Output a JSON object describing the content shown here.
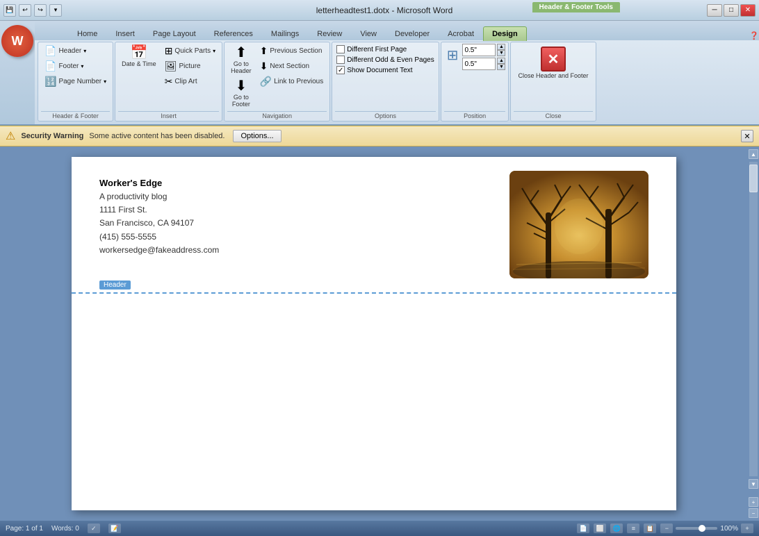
{
  "titlebar": {
    "title": "letterheadtest1.dotx - Microsoft Word",
    "htf_label": "Header & Footer Tools",
    "min_btn": "─",
    "max_btn": "□",
    "close_btn": "✕"
  },
  "quickaccess": {
    "btns": [
      "💾",
      "↩",
      "↪",
      "⊞",
      "▾"
    ]
  },
  "tabs": [
    {
      "label": "Home",
      "key": "H"
    },
    {
      "label": "Insert",
      "key": "N"
    },
    {
      "label": "Page Layout",
      "key": "P"
    },
    {
      "label": "References",
      "key": "S"
    },
    {
      "label": "Mailings",
      "key": "M"
    },
    {
      "label": "Review",
      "key": "R"
    },
    {
      "label": "View",
      "key": "W"
    },
    {
      "label": "Developer",
      "key": "L"
    },
    {
      "label": "Acrobat",
      "key": "B"
    },
    {
      "label": "Design",
      "key": "JH",
      "active": true
    }
  ],
  "groups": {
    "header_footer": {
      "label": "Header & Footer",
      "header_btn": "Header",
      "footer_btn": "Footer",
      "page_num_btn": "Page Number"
    },
    "insert": {
      "label": "Insert",
      "date_time_btn": "Date & Time",
      "quick_parts_btn": "Quick Parts",
      "picture_btn": "Picture",
      "clip_art_btn": "Clip Art"
    },
    "navigation": {
      "label": "Navigation",
      "go_to_header_btn": "Go to Header",
      "go_to_footer_btn": "Go to Footer",
      "prev_section_btn": "Previous Section",
      "next_section_btn": "Next Section",
      "link_to_prev_btn": "Link to Previous"
    },
    "options": {
      "label": "Options",
      "diff_first_cb": "Different First Page",
      "diff_odd_even_cb": "Different Odd & Even Pages",
      "show_doc_text_cb": "Show Document Text",
      "show_doc_text_checked": true
    },
    "position": {
      "label": "Position",
      "header_pos_label": "0.5\"",
      "footer_pos_label": "0.5\""
    },
    "close": {
      "label": "Close",
      "close_btn": "Close Header and Footer"
    }
  },
  "security": {
    "title": "Security Warning",
    "message": "Some active content has been disabled.",
    "options_btn": "Options...",
    "icon": "⚠"
  },
  "document": {
    "header": {
      "company": "Worker's Edge",
      "lines": [
        "A productivity blog",
        "1111 First St.",
        "San Francisco, CA 94107",
        "(415) 555-5555",
        "workersedge@fakeaddress.com"
      ],
      "label": "Header"
    }
  },
  "statusbar": {
    "page_info": "Page: 1 of 1",
    "words": "Words: 0",
    "zoom": "100%"
  }
}
